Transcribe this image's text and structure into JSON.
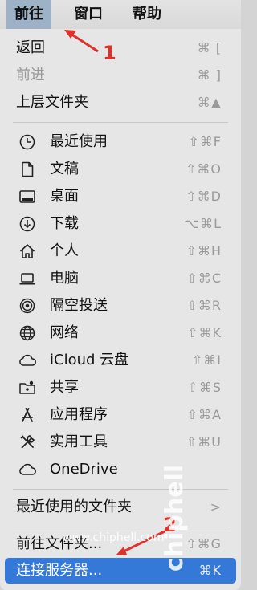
{
  "menubar": {
    "items": [
      {
        "label": "前往"
      },
      {
        "label": "窗口"
      },
      {
        "label": "帮助"
      }
    ]
  },
  "menu": {
    "items": [
      {
        "label": "返回",
        "shortcut": "⌘ ["
      },
      {
        "label": "前进",
        "shortcut": "⌘ ]",
        "disabled": true
      },
      {
        "label": "上层文件夹",
        "shortcut": "⌘▲"
      },
      {
        "label": "最近使用",
        "shortcut": "⇧⌘F",
        "icon": "clock-icon"
      },
      {
        "label": "文稿",
        "shortcut": "⇧⌘O",
        "icon": "document-icon"
      },
      {
        "label": "桌面",
        "shortcut": "⇧⌘D",
        "icon": "desktop-icon"
      },
      {
        "label": "下载",
        "shortcut": "⌥⌘L",
        "icon": "download-icon"
      },
      {
        "label": "个人",
        "shortcut": "⇧⌘H",
        "icon": "home-icon"
      },
      {
        "label": "电脑",
        "shortcut": "⇧⌘C",
        "icon": "laptop-icon"
      },
      {
        "label": "隔空投送",
        "shortcut": "⇧⌘R",
        "icon": "airdrop-icon"
      },
      {
        "label": "网络",
        "shortcut": "⇧⌘K",
        "icon": "globe-icon"
      },
      {
        "label": "iCloud 云盘",
        "shortcut": "⇧⌘I",
        "icon": "cloud-icon"
      },
      {
        "label": "共享",
        "shortcut": "⇧⌘S",
        "icon": "shared-folder-icon"
      },
      {
        "label": "应用程序",
        "shortcut": "⇧⌘A",
        "icon": "applications-icon"
      },
      {
        "label": "实用工具",
        "shortcut": "⇧⌘U",
        "icon": "tools-icon"
      },
      {
        "label": "OneDrive",
        "shortcut": "",
        "icon": "cloud-icon"
      },
      {
        "label": "最近使用的文件夹",
        "shortcut": ">"
      },
      {
        "label": "前往文件夹...",
        "shortcut": "⇧⌘G"
      },
      {
        "label": "连接服务器...",
        "shortcut": "⌘K"
      }
    ]
  },
  "annotations": {
    "marker1": "1",
    "marker2": "2"
  },
  "watermark": {
    "logo": "chiphell",
    "url": "www.chiphell.com"
  },
  "colors": {
    "highlight": "#3479d8",
    "menubar_active": "#9db2c6",
    "annotation": "#e0302a"
  }
}
